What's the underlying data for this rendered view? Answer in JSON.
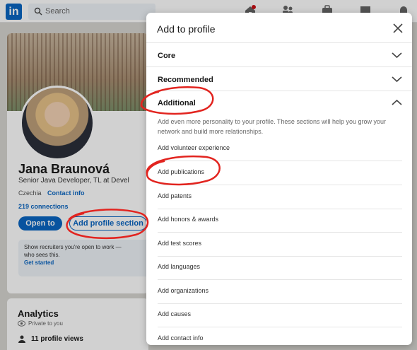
{
  "topbar": {
    "logo_text": "in",
    "search_placeholder": "Search"
  },
  "profile": {
    "name": "Jana Braunová",
    "headline": "Senior Java Developer, TL at Devel",
    "location": "Czechia",
    "contact_info": "Contact info",
    "connections": "219 connections",
    "open_to_button": "Open to",
    "add_section_button": "Add profile section",
    "open_to_work_line1": "Show recruiters you're open to work —",
    "open_to_work_line2": "who sees this.",
    "open_to_work_link": "Get started"
  },
  "analytics": {
    "title": "Analytics",
    "privacy": "Private to you",
    "profile_views": "11 profile views"
  },
  "modal": {
    "title": "Add to profile",
    "sections": [
      {
        "label": "Core",
        "expanded": false
      },
      {
        "label": "Recommended",
        "expanded": false
      },
      {
        "label": "Additional",
        "expanded": true
      }
    ],
    "additional_description": "Add even more personality to your profile. These sections will help you grow your network and build more relationships.",
    "additional_items": [
      "Add volunteer experience",
      "Add publications",
      "Add patents",
      "Add honors & awards",
      "Add test scores",
      "Add languages",
      "Add organizations",
      "Add causes",
      "Add contact info"
    ]
  },
  "colors": {
    "brand": "#0a66c2",
    "annotation": "#e2241f"
  }
}
